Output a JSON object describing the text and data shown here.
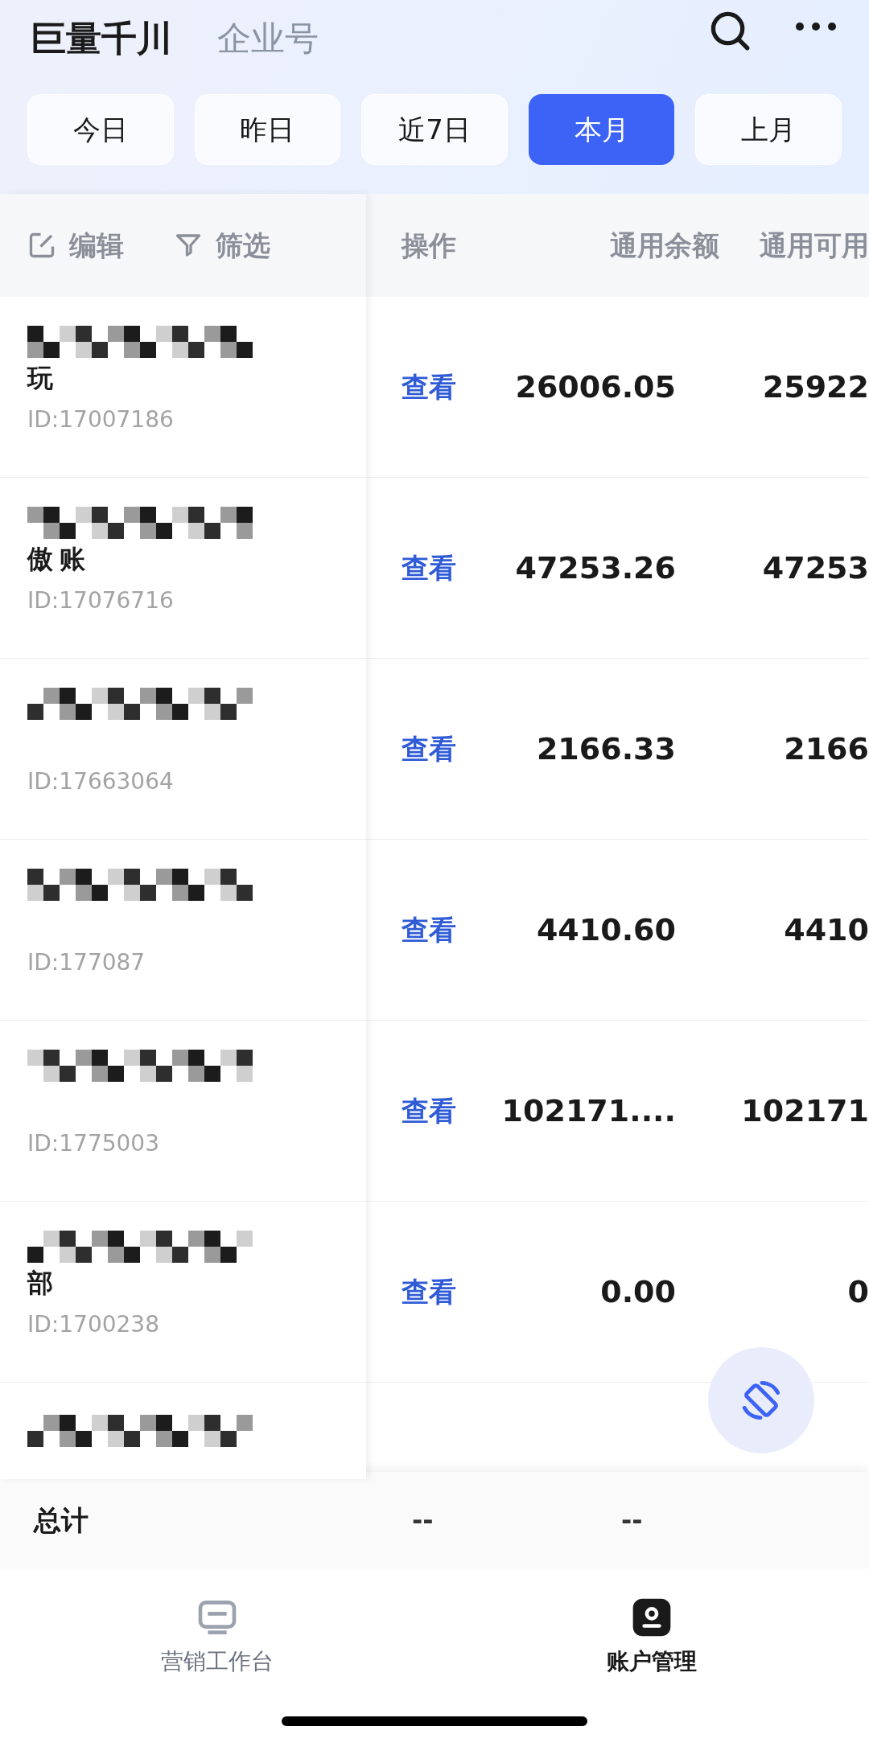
{
  "header": {
    "title": "巨量千川",
    "subtitle": "企业号"
  },
  "date_tabs": [
    {
      "label": "今日",
      "selected": false
    },
    {
      "label": "昨日",
      "selected": false
    },
    {
      "label": "近7日",
      "selected": false
    },
    {
      "label": "本月",
      "selected": true
    },
    {
      "label": "上月",
      "selected": false
    }
  ],
  "toolbar": {
    "edit": "编辑",
    "filter": "筛选"
  },
  "table": {
    "columns": [
      "操作",
      "通用余额",
      "通用可用"
    ],
    "rows": [
      {
        "name_lines": [
          "玩"
        ],
        "id": "ID:17007186",
        "action": "查看",
        "balance": "26006.05",
        "available": "25922"
      },
      {
        "name_lines": [
          "傲",
          "账"
        ],
        "id": "ID:17076716",
        "action": "查看",
        "balance": "47253.26",
        "available": "47253"
      },
      {
        "id": "ID:17663064",
        "action": "查看",
        "balance": "2166.33",
        "available": "2166"
      },
      {
        "id": "ID:177087",
        "action": "查看",
        "balance": "4410.60",
        "available": "4410"
      },
      {
        "id": "ID:1775003",
        "action": "查看",
        "balance": "102171....",
        "available": "102171"
      },
      {
        "name_lines": [
          "部"
        ],
        "id": "ID:1700238",
        "action": "查看",
        "balance": "0.00",
        "available": "0"
      }
    ]
  },
  "total": {
    "label": "总计",
    "values": [
      "--",
      "--"
    ]
  },
  "bottom_nav": [
    {
      "label": "营销工作台",
      "selected": false
    },
    {
      "label": "账户管理",
      "selected": true
    }
  ]
}
